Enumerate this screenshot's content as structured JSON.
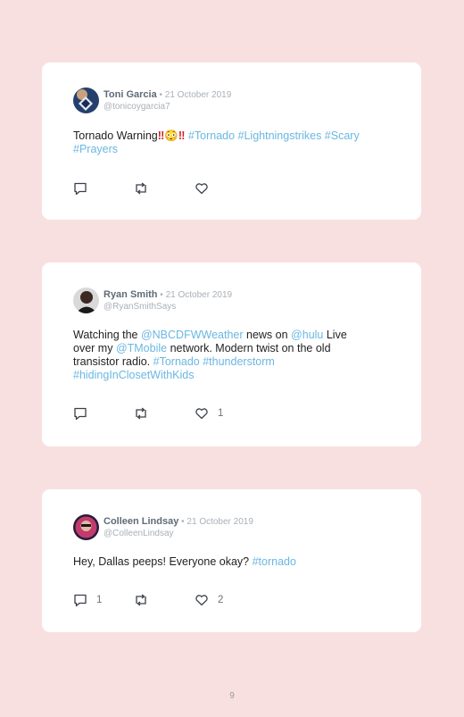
{
  "tweets": [
    {
      "name": "Toni Garcia",
      "date": " • 21 October 2019",
      "handle": "@tonicoygarcia7",
      "text_parts": [
        "Tornado Warning",
        "‼",
        "😳",
        "‼",
        " ",
        "#Tornado #Lightningstrikes #Scary",
        "#Prayers"
      ],
      "reply_count": "",
      "retweet_count": "",
      "like_count": ""
    },
    {
      "name": "Ryan Smith",
      "date": " • 21 October 2019",
      "handle": "@RyanSmithSays",
      "text_parts": [
        "Watching the ",
        "@NBCDFWWeather",
        " news on ",
        "@hulu",
        " Live",
        "over my ",
        "@TMobile",
        " network. Modern twist on the old",
        "transistor radio. ",
        "#Tornado #thunderstorm",
        "#hidingInClosetWithKids"
      ],
      "reply_count": "",
      "retweet_count": "",
      "like_count": "1"
    },
    {
      "name": "Colleen Lindsay",
      "date": " • 21 October 2019",
      "handle": "@ColleenLindsay",
      "text_parts": [
        "Hey, Dallas peeps! Everyone okay? ",
        "#tornado"
      ],
      "reply_count": "1",
      "retweet_count": "",
      "like_count": "2"
    }
  ],
  "page_number": "9",
  "icons": [
    "reply-icon",
    "retweet-icon",
    "like-icon"
  ],
  "colors": {
    "background": "#f9e0e0",
    "link": "#6ab7e2",
    "card": "#ffffff"
  }
}
